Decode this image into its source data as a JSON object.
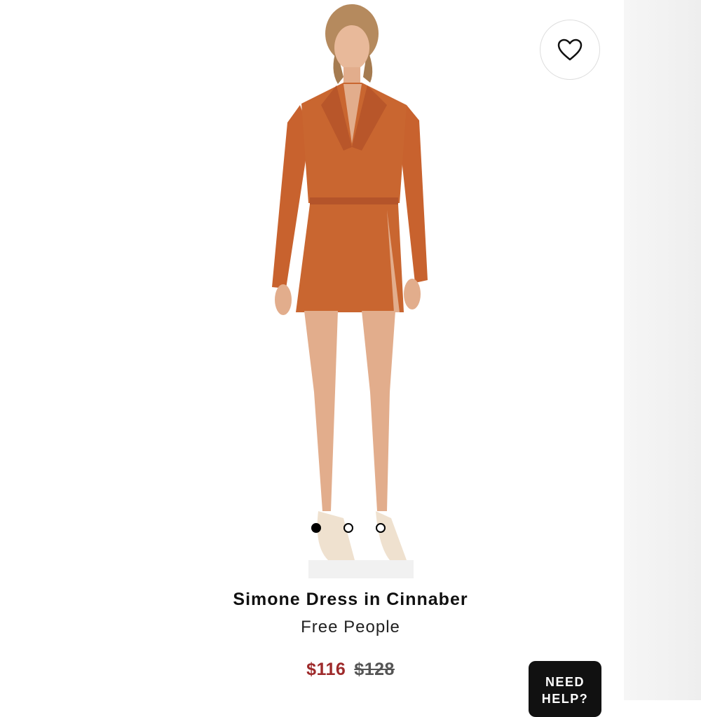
{
  "product": {
    "title": "Simone Dress in Cinnaber",
    "brand": "Free People",
    "price_sale": "$116",
    "price_original": "$128"
  },
  "gallery": {
    "image_count": 3,
    "active_index": 0
  },
  "favorite": {
    "icon": "heart-outline-icon"
  },
  "help": {
    "label": "NEED HELP?"
  },
  "colors": {
    "dress": "#c8622e",
    "sale_price": "#9e2a2b",
    "help_bg": "#111111"
  }
}
